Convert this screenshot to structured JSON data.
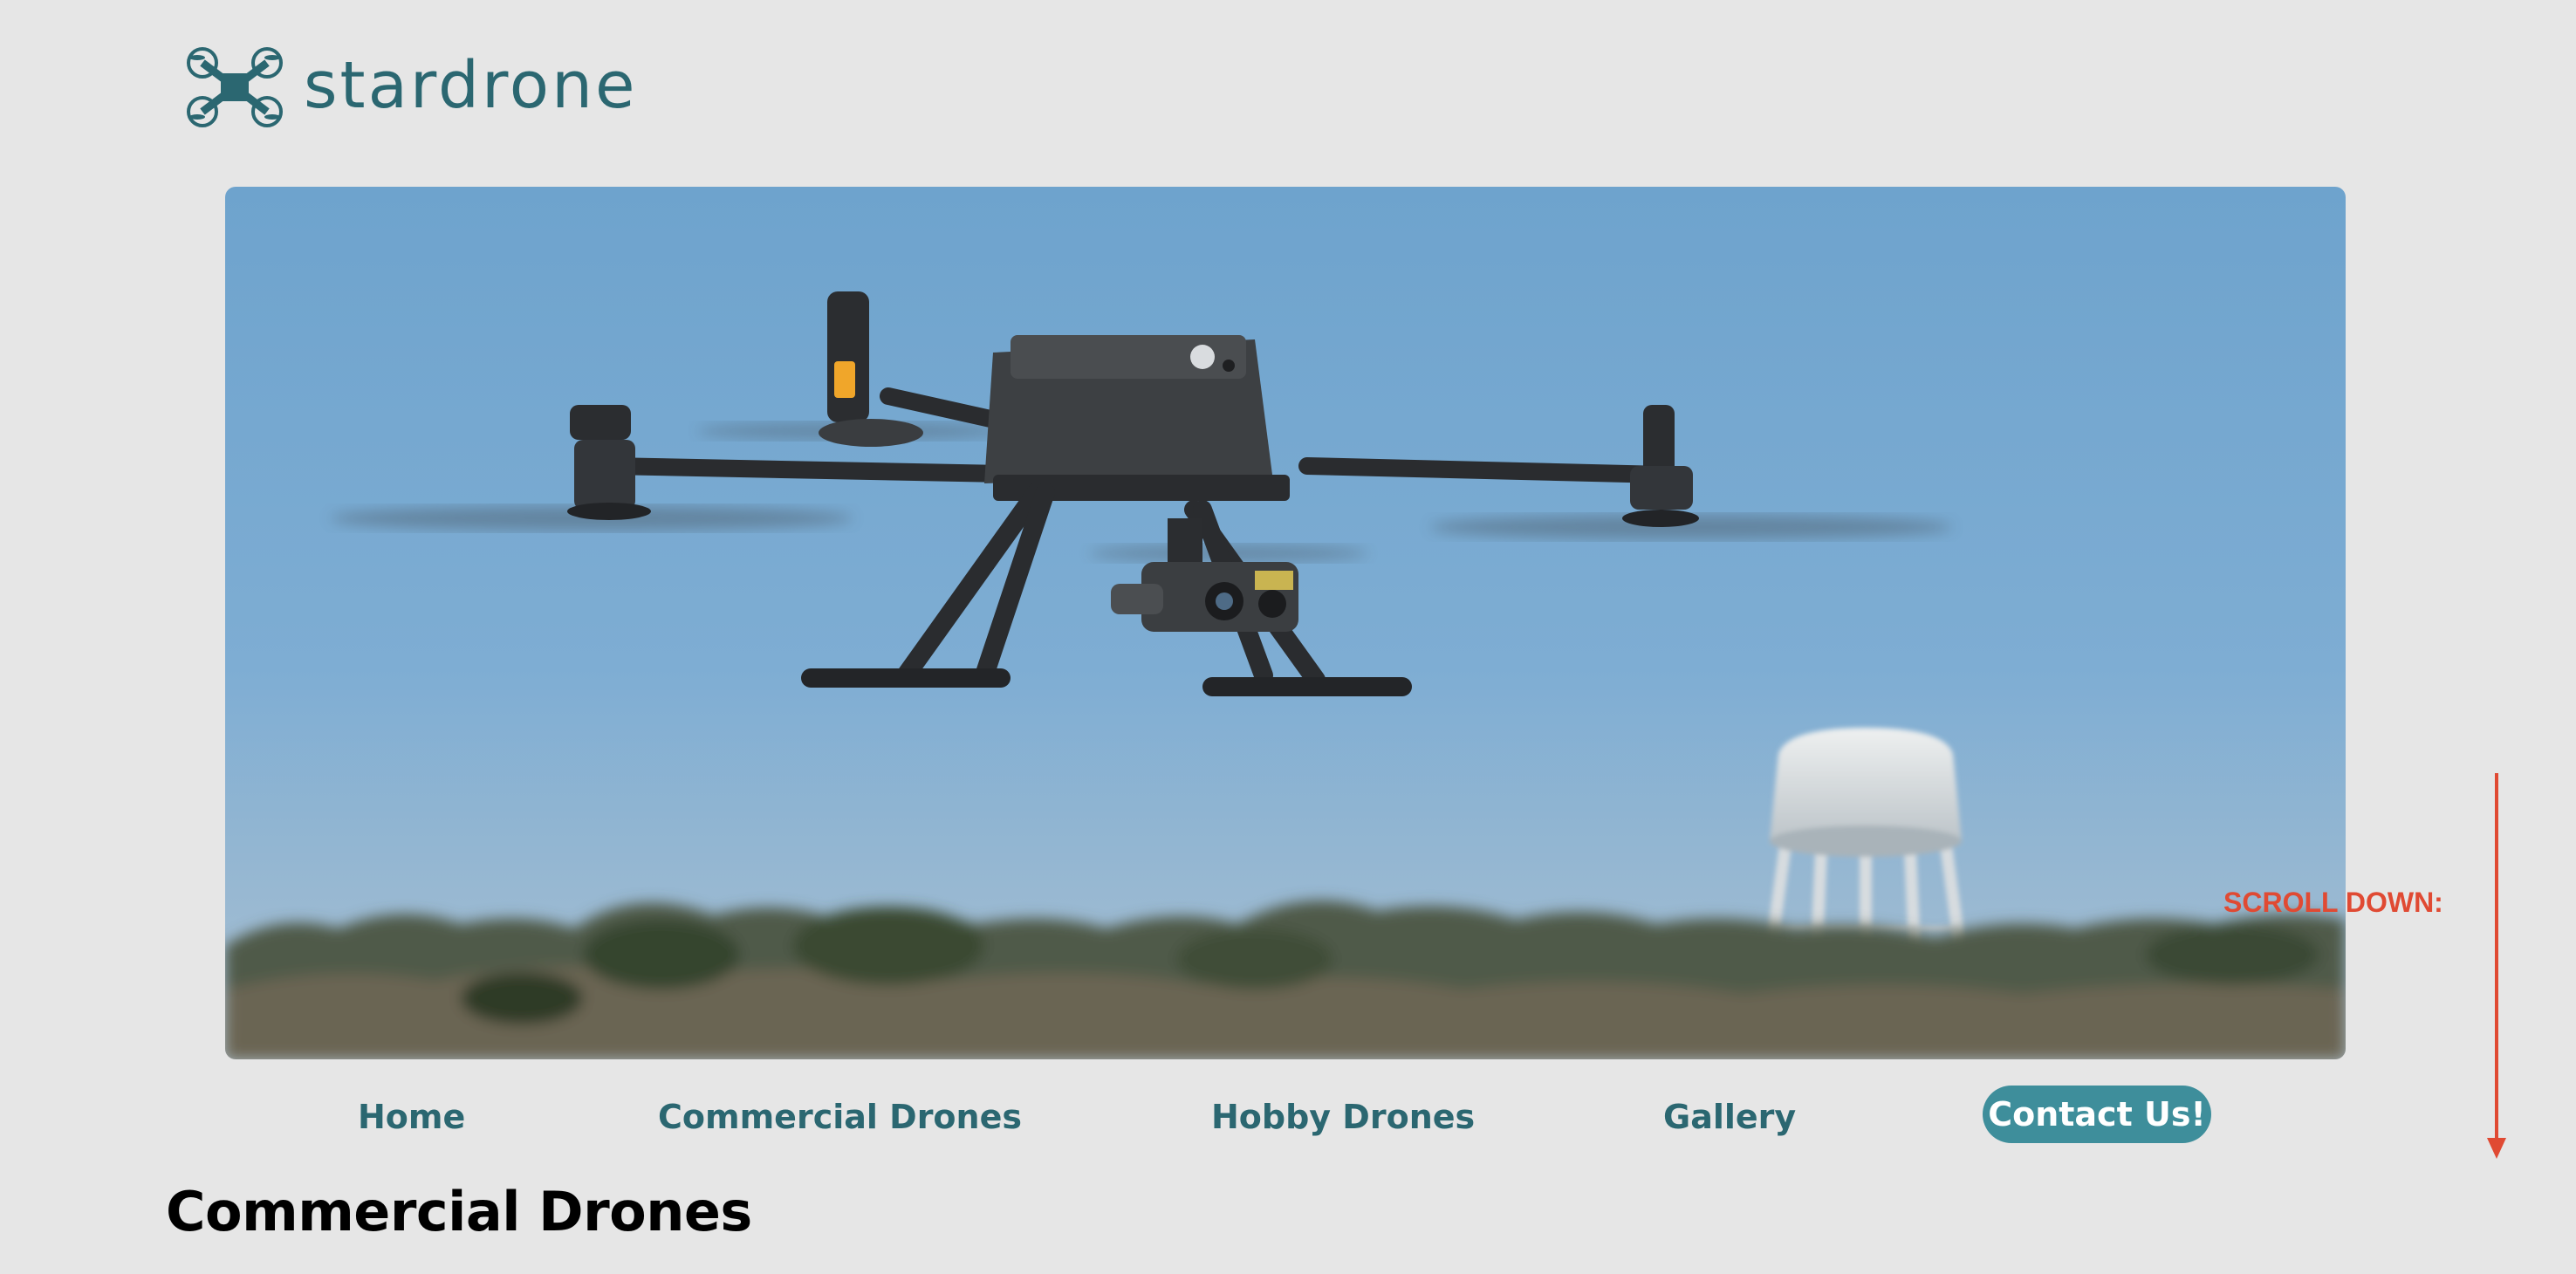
{
  "brand": {
    "name": "stardrone",
    "logo_icon": "quadcopter-icon",
    "color": "#2b6771"
  },
  "hero": {
    "image_subject": "drone-photo"
  },
  "scroll_hint": {
    "label": "SCROLL DOWN:",
    "icon": "down-arrow-icon",
    "color": "#e04a33"
  },
  "nav": {
    "items": [
      {
        "label": "Home"
      },
      {
        "label": "Commercial Drones"
      },
      {
        "label": "Hobby Drones"
      },
      {
        "label": "Gallery"
      }
    ],
    "cta_label": "Contact Us!",
    "cta_color": "#3e8e9b"
  },
  "page": {
    "heading": "Commercial Drones"
  }
}
